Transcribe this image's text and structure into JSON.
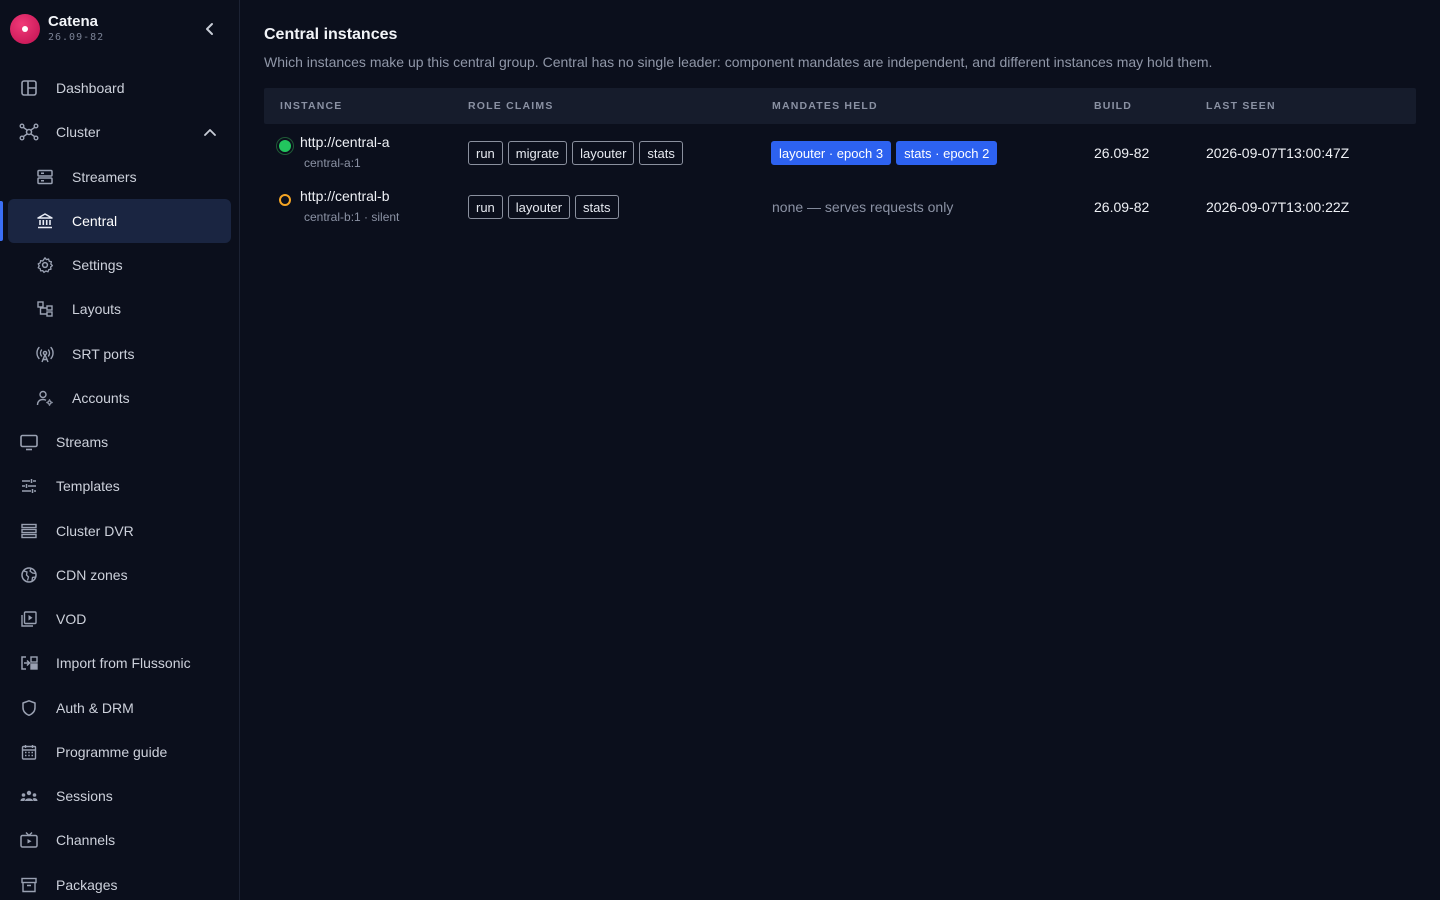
{
  "app": {
    "name": "Catena",
    "version": "26.09-82"
  },
  "sidebar": {
    "items": [
      {
        "label": "Dashboard",
        "icon": "dashboard-icon"
      },
      {
        "label": "Cluster",
        "icon": "cluster-icon",
        "expanded": true
      },
      {
        "label": "Streamers",
        "icon": "server-icon"
      },
      {
        "label": "Central",
        "icon": "bank-icon",
        "active": true
      },
      {
        "label": "Settings",
        "icon": "gear-icon"
      },
      {
        "label": "Layouts",
        "icon": "layout-tree-icon"
      },
      {
        "label": "SRT ports",
        "icon": "antenna-icon"
      },
      {
        "label": "Accounts",
        "icon": "user-gear-icon"
      },
      {
        "label": "Streams",
        "icon": "monitor-icon"
      },
      {
        "label": "Templates",
        "icon": "sliders-icon"
      },
      {
        "label": "Cluster DVR",
        "icon": "stack-icon"
      },
      {
        "label": "CDN zones",
        "icon": "globe-icon"
      },
      {
        "label": "VOD",
        "icon": "video-library-icon"
      },
      {
        "label": "Import from Flussonic",
        "icon": "import-icon"
      },
      {
        "label": "Auth & DRM",
        "icon": "shield-icon"
      },
      {
        "label": "Programme guide",
        "icon": "calendar-icon"
      },
      {
        "label": "Sessions",
        "icon": "users-icon"
      },
      {
        "label": "Channels",
        "icon": "tv-icon"
      },
      {
        "label": "Packages",
        "icon": "archive-icon"
      }
    ]
  },
  "main": {
    "title": "Central instances",
    "description": "Which instances make up this central group. Central has no single leader: component mandates are independent, and different instances may hold them.",
    "columns": [
      "Instance",
      "Role claims",
      "Mandates held",
      "Build",
      "Last seen"
    ],
    "rows": [
      {
        "status": "online",
        "status_color": "#22c55e",
        "url": "http://central-a",
        "sub": "central-a:1",
        "roles": [
          "run",
          "migrate",
          "layouter",
          "stats"
        ],
        "mandates": [
          "layouter · epoch 3",
          "stats · epoch 2"
        ],
        "mandates_text": "",
        "build": "26.09-82",
        "last_seen": "2026-09-07T13:00:47Z"
      },
      {
        "status": "silent",
        "status_color": "#f5a524",
        "url": "http://central-b",
        "sub": "central-b:1 · silent",
        "roles": [
          "run",
          "layouter",
          "stats"
        ],
        "mandates": [],
        "mandates_text": "none — serves requests only",
        "build": "26.09-82",
        "last_seen": "2026-09-07T13:00:22Z"
      }
    ]
  },
  "colors": {
    "background": "#0b0f1c",
    "accent": "#2d62f0",
    "active_nav": "#1a2541"
  }
}
